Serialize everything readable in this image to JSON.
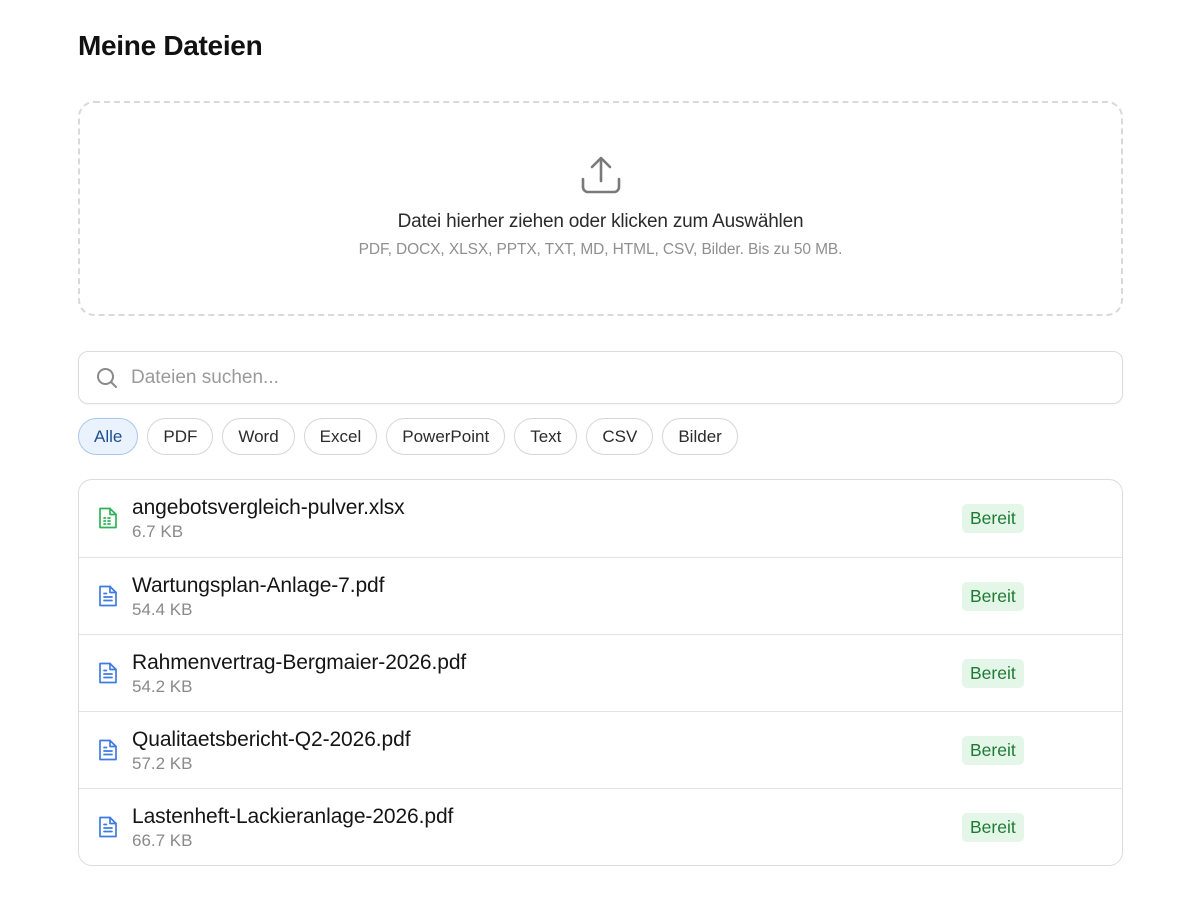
{
  "page": {
    "title": "Meine Dateien"
  },
  "dropzone": {
    "icon": "upload-icon",
    "title": "Datei hierher ziehen oder klicken zum Auswählen",
    "hint": "PDF, DOCX, XLSX, PPTX, TXT, MD, HTML, CSV, Bilder. Bis zu 50 MB."
  },
  "search": {
    "icon": "search-icon",
    "placeholder": "Dateien suchen...",
    "value": ""
  },
  "filters": {
    "active": "Alle",
    "items": [
      "Alle",
      "PDF",
      "Word",
      "Excel",
      "PowerPoint",
      "Text",
      "CSV",
      "Bilder"
    ]
  },
  "files": [
    {
      "name": "angebotsvergleich-pulver.xlsx",
      "size": "6.7 KB",
      "status": "Bereit",
      "icon": "spreadsheet-file-icon"
    },
    {
      "name": "Wartungsplan-Anlage-7.pdf",
      "size": "54.4 KB",
      "status": "Bereit",
      "icon": "document-file-icon"
    },
    {
      "name": "Rahmenvertrag-Bergmaier-2026.pdf",
      "size": "54.2 KB",
      "status": "Bereit",
      "icon": "document-file-icon"
    },
    {
      "name": "Qualitaetsbericht-Q2-2026.pdf",
      "size": "57.2 KB",
      "status": "Bereit",
      "icon": "document-file-icon"
    },
    {
      "name": "Lastenheft-Lackieranlage-2026.pdf",
      "size": "66.7 KB",
      "status": "Bereit",
      "icon": "document-file-icon"
    }
  ],
  "colors": {
    "accent": "#1f4f91",
    "status_ready_bg": "#e4f6e8",
    "status_ready_text": "#1f7a35",
    "spreadsheet_icon": "#2fb358",
    "document_icon": "#3f7be0"
  }
}
